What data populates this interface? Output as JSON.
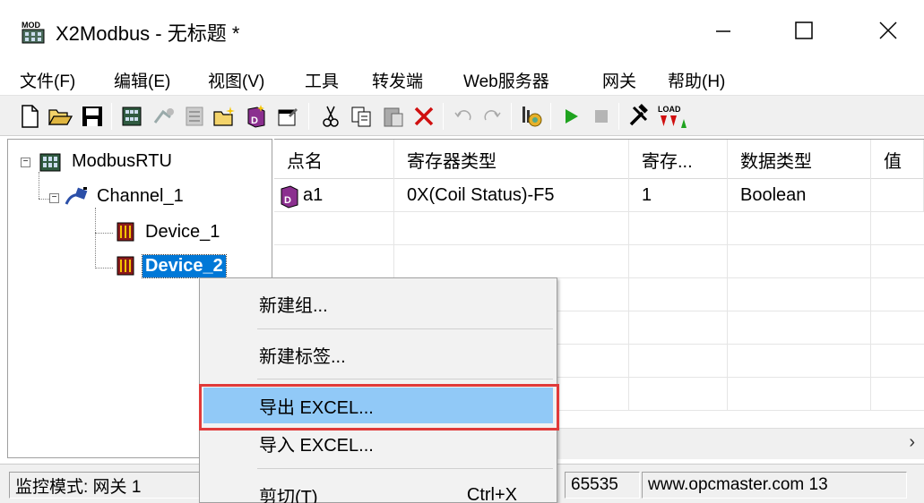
{
  "window": {
    "title": "X2Modbus - 无标题 *",
    "app_icon_text": "MOD",
    "minimize_glyph": "—",
    "maximize_glyph": "☐",
    "close_glyph": "✕"
  },
  "menu": [
    "文件(F)",
    "编辑(E)",
    "视图(V)",
    "工具",
    "转发端",
    "Web服务器",
    "网关",
    "帮助(H)"
  ],
  "toolbar": {
    "icons": [
      "new-icon",
      "open-icon",
      "save-icon",
      "add-channel-icon",
      "add-device-icon",
      "device-list-icon",
      "new-group-icon",
      "add-tag-icon",
      "properties-icon",
      "cut-icon",
      "copy-icon",
      "paste-icon",
      "delete-icon",
      "undo-icon",
      "redo-icon",
      "monitor-icon",
      "run-icon",
      "stop-icon",
      "tools-icon",
      "load-icon"
    ],
    "load_text": "LOAD",
    "run_color": "#1fa31f",
    "delete_color": "#d01010"
  },
  "tree": {
    "root": "ModbusRTU",
    "channel": "Channel_1",
    "devices": [
      "Device_1",
      "Device_2"
    ],
    "selected_device": "Device_2"
  },
  "table": {
    "columns": [
      "点名",
      "寄存器类型",
      "寄存...",
      "数据类型",
      "值"
    ],
    "rows": [
      {
        "name": "a1",
        "register_type": "0X(Coil Status)-F5",
        "register": "1",
        "data_type": "Boolean",
        "value": ""
      }
    ],
    "scroll_arrow": "›"
  },
  "context_menu": {
    "items": [
      {
        "label": "新建组...",
        "shortcut": ""
      },
      {
        "label": "新建标签...",
        "shortcut": ""
      },
      {
        "label": "导出 EXCEL...",
        "shortcut": "",
        "highlighted": true
      },
      {
        "label": "导入 EXCEL...",
        "shortcut": ""
      },
      {
        "label": "剪切(T)",
        "shortcut": "Ctrl+X"
      }
    ],
    "highlight_color": "#91c9f7",
    "annotation_color": "#e03a3a"
  },
  "statusbar": {
    "mode": "监控模式: 网关 1",
    "port": "65535",
    "website": "www.opcmaster.com 13"
  }
}
